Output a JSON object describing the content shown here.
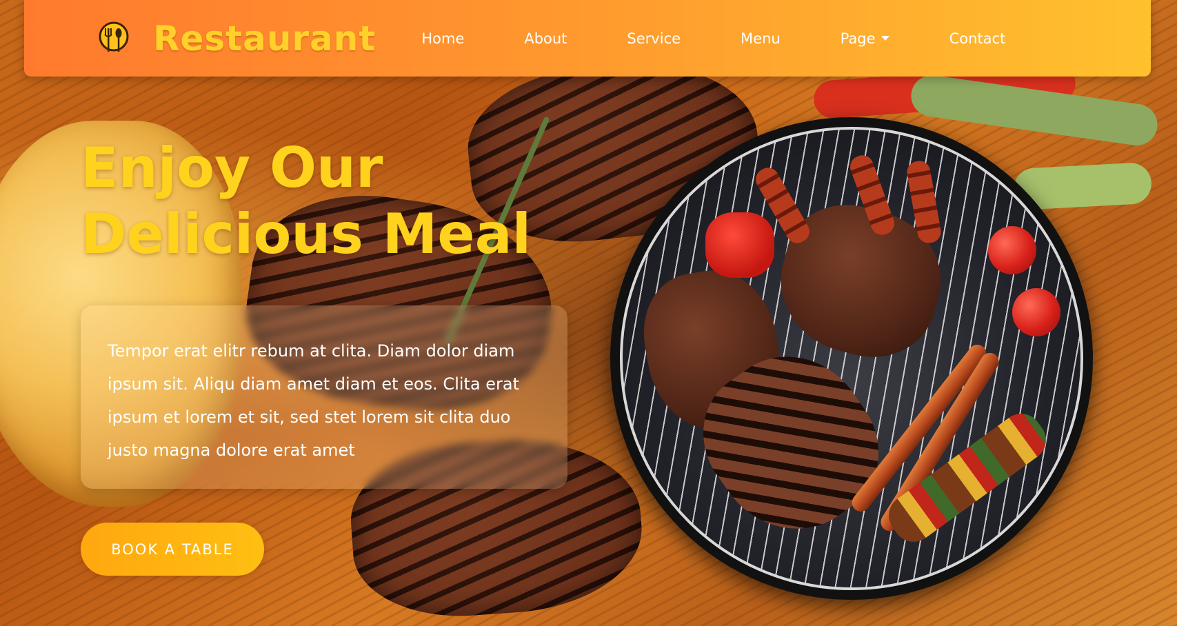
{
  "navbar": {
    "brand_name": "Restaurant",
    "logo_icon": "utensils-circle-icon",
    "links": [
      {
        "label": "Home"
      },
      {
        "label": "About"
      },
      {
        "label": "Service"
      },
      {
        "label": "Menu"
      },
      {
        "label": "Page",
        "has_dropdown": true
      },
      {
        "label": "Contact"
      }
    ]
  },
  "hero": {
    "title_line1": "Enjoy Our",
    "title_line2": "Delicious Meal",
    "description": "Tempor erat elitr rebum at clita. Diam dolor diam ipsum sit. Aliqu diam amet diam et eos. Clita erat ipsum et lorem et sit, sed stet lorem sit clita duo justo magna dolore erat amet",
    "cta_label": "BOOK A TABLE",
    "background_image": "grilled-meat-barbecue"
  },
  "colors": {
    "navbar_gradient_start": "#ff7a2e",
    "navbar_gradient_end": "#ffc12e",
    "brand": "#ffd12a",
    "title": "#ffd21e",
    "button": "#ffae10"
  }
}
